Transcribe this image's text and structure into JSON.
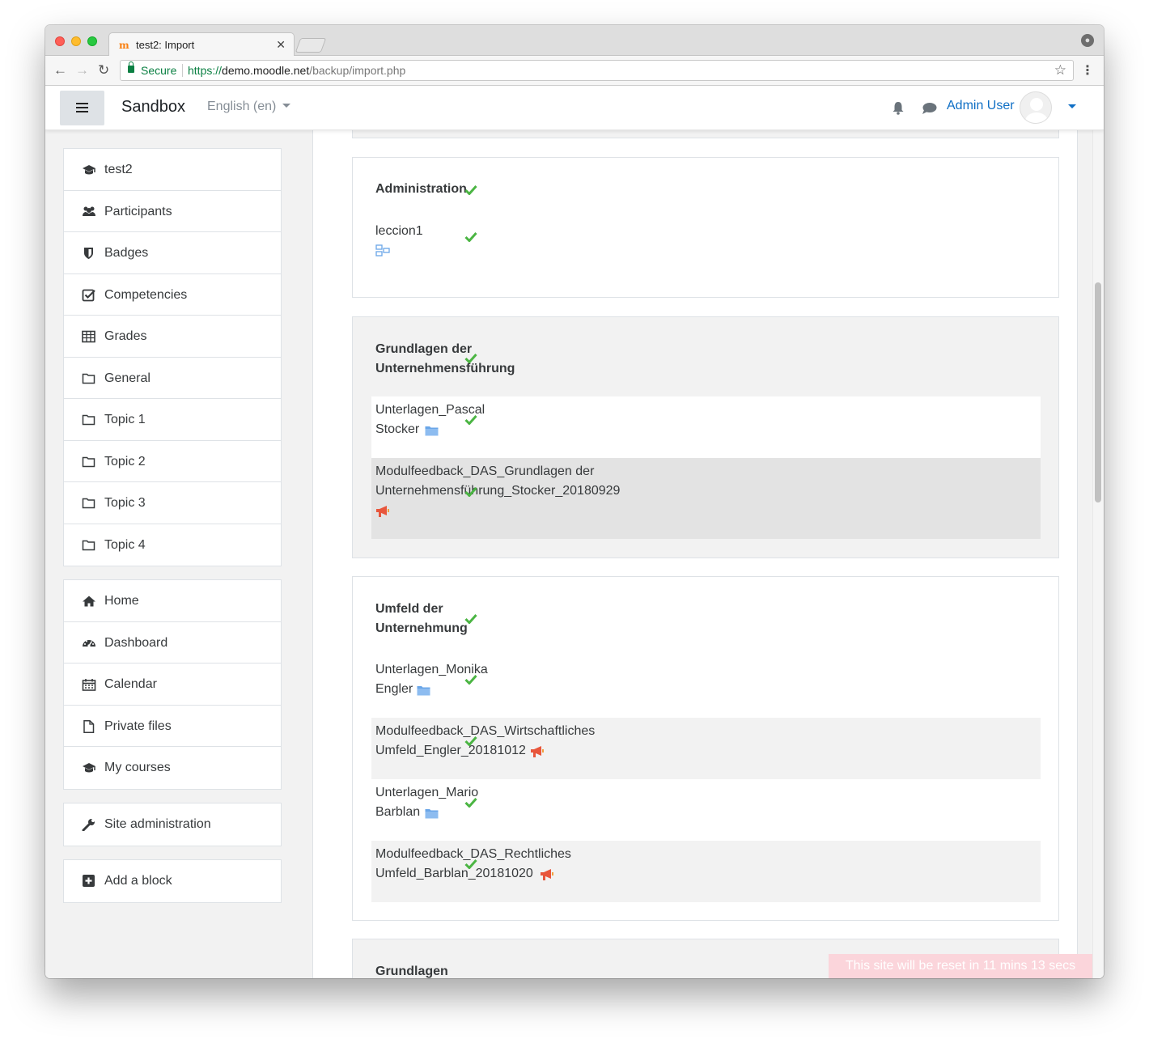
{
  "browser": {
    "tab_title": "test2: Import",
    "tab_favicon": "m",
    "secure_label": "Secure",
    "url_scheme": "https://",
    "url_host": "demo.moodle.net",
    "url_path": "/backup/import.php"
  },
  "navbar": {
    "brand": "Sandbox",
    "language": "English (en)",
    "user_name": "Admin User"
  },
  "drawer": {
    "course_nav": [
      {
        "label": "test2",
        "icon": "graduation-cap-icon"
      },
      {
        "label": "Participants",
        "icon": "users-icon"
      },
      {
        "label": "Badges",
        "icon": "shield-icon"
      },
      {
        "label": "Competencies",
        "icon": "check-square-icon"
      },
      {
        "label": "Grades",
        "icon": "table-icon"
      },
      {
        "label": "General",
        "icon": "folder-icon"
      },
      {
        "label": "Topic 1",
        "icon": "folder-icon"
      },
      {
        "label": "Topic 2",
        "icon": "folder-icon"
      },
      {
        "label": "Topic 3",
        "icon": "folder-icon"
      },
      {
        "label": "Topic 4",
        "icon": "folder-icon"
      }
    ],
    "site_nav": [
      {
        "label": "Home",
        "icon": "home-icon"
      },
      {
        "label": "Dashboard",
        "icon": "dashboard-icon"
      },
      {
        "label": "Calendar",
        "icon": "calendar-icon"
      },
      {
        "label": "Private files",
        "icon": "file-icon"
      },
      {
        "label": "My courses",
        "icon": "graduation-cap-icon"
      }
    ],
    "site_admin": {
      "label": "Site administration",
      "icon": "wrench-icon"
    },
    "add_block": {
      "label": "Add a block",
      "icon": "plus-square-icon"
    }
  },
  "sections": [
    {
      "title": "Administration",
      "rows": [
        {
          "text": "leccion1",
          "icon": "page-icon"
        }
      ]
    },
    {
      "title": "Grundlagen der\nUnternehmensführung",
      "rows": [
        {
          "text": "Unterlagen_Pascal\nStocker",
          "icon": "folder-icon"
        },
        {
          "text": "Modulfeedback_DAS_Grundlagen der\nUnternehmensführung_Stocker_20180929",
          "icon": "feedback-megaphone-icon"
        }
      ]
    },
    {
      "title": "Umfeld der\nUnternehmung",
      "rows": [
        {
          "text": "Unterlagen_Monika\nEngler",
          "icon": "folder-icon"
        },
        {
          "text": "Modulfeedback_DAS_Wirtschaftliches\nUmfeld_Engler_20181012",
          "icon": "feedback-megaphone-icon"
        },
        {
          "text": "Unterlagen_Mario\nBarblan",
          "icon": "folder-icon"
        },
        {
          "text": "Modulfeedback_DAS_Rechtliches\nUmfeld_Barblan_20181020",
          "icon": "feedback-megaphone-icon"
        }
      ]
    },
    {
      "title": "Grundlagen",
      "rows": []
    }
  ],
  "reset_banner": "This site will be reset in 11 mins 13 secs",
  "colors": {
    "check": "#4bb543",
    "link": "#0f6fc5",
    "folder": "#6aa6e8",
    "megaphone": "#e8563c",
    "banner": "#fbd5db"
  }
}
